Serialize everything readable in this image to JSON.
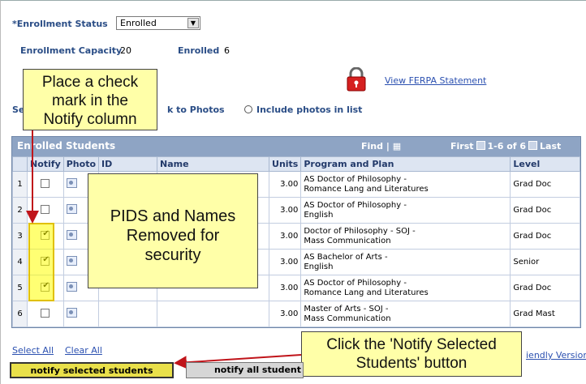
{
  "enrollment": {
    "status_label": "*Enrollment Status",
    "status_value": "Enrolled",
    "capacity_label": "Enrollment Capacity",
    "capacity_value": "20",
    "enrolled_label": "Enrolled",
    "enrolled_value": "6"
  },
  "ferpa_link": "View FERPA Statement",
  "photo_options": {
    "left_fragment": "Se",
    "left_option": "k to Photos",
    "right_option": "Include photos in list"
  },
  "grid": {
    "title": "Enrolled Students",
    "find": "Find |",
    "nav": {
      "first": "First",
      "range": "1-6 of 6",
      "last": "Last"
    },
    "columns": [
      "",
      "Notify",
      "Photo",
      "ID",
      "Name",
      "Units",
      "Program and Plan",
      "Level"
    ],
    "rows": [
      {
        "n": "1",
        "notify": false,
        "units": "3.00",
        "program": [
          "AS Doctor of Philosophy -",
          "Romance Lang and Literatures"
        ],
        "level": "Grad Doc"
      },
      {
        "n": "2",
        "notify": false,
        "units": "3.00",
        "program": [
          "AS Doctor of Philosophy -",
          "English"
        ],
        "level": "Grad Doc"
      },
      {
        "n": "3",
        "notify": true,
        "units": "3.00",
        "program": [
          "Doctor of Philosophy - SOJ -",
          "Mass Communication"
        ],
        "level": "Grad Doc"
      },
      {
        "n": "4",
        "notify": true,
        "units": "3.00",
        "program": [
          "AS Bachelor of Arts -",
          "English"
        ],
        "level": "Senior"
      },
      {
        "n": "5",
        "notify": true,
        "units": "3.00",
        "program": [
          "AS Doctor of Philosophy -",
          "Romance Lang and Literatures"
        ],
        "level": "Grad Doc"
      },
      {
        "n": "6",
        "notify": false,
        "units": "3.00",
        "program": [
          "Master of Arts - SOJ -",
          "Mass Communication"
        ],
        "level": "Grad Mast"
      }
    ]
  },
  "links": {
    "select_all": "Select All",
    "clear_all": "Clear All",
    "friendly": "iendly Version"
  },
  "buttons": {
    "notify_selected": "notify selected students",
    "notify_all": "notify all student"
  },
  "callouts": {
    "check": [
      "Place a check",
      "mark in the",
      "Notify column"
    ],
    "pids": [
      "PIDS and Names",
      "Removed for",
      "security"
    ],
    "click": [
      "Click the 'Notify Selected",
      "Students' button"
    ]
  },
  "colors": {
    "label": "#2a4d86",
    "grid_header": "#8ea4c4",
    "callout": "#ffffa8",
    "arrow": "#c0141a",
    "button_selected": "#e9e04a"
  }
}
